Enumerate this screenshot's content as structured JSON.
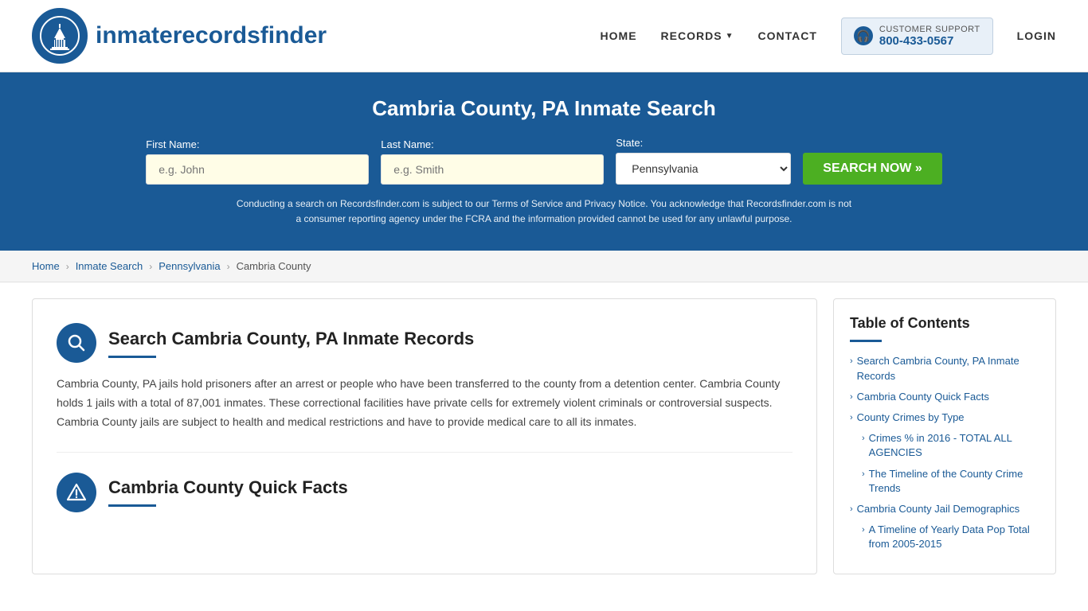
{
  "header": {
    "logo_text_normal": "inmaterecords",
    "logo_text_bold": "finder",
    "nav": {
      "home": "HOME",
      "records": "RECORDS",
      "contact": "CONTACT",
      "login": "LOGIN"
    },
    "support": {
      "label": "CUSTOMER SUPPORT",
      "phone": "800-433-0567"
    }
  },
  "search_banner": {
    "title": "Cambria County, PA Inmate Search",
    "form": {
      "first_name_label": "First Name:",
      "first_name_placeholder": "e.g. John",
      "last_name_label": "Last Name:",
      "last_name_placeholder": "e.g. Smith",
      "state_label": "State:",
      "state_value": "Pennsylvania",
      "search_button": "SEARCH NOW »"
    },
    "disclaimer": "Conducting a search on Recordsfinder.com is subject to our Terms of Service and Privacy Notice. You acknowledge that Recordsfinder.com is not a consumer reporting agency under the FCRA and the information provided cannot be used for any unlawful purpose."
  },
  "breadcrumb": {
    "items": [
      "Home",
      "Inmate Search",
      "Pennsylvania",
      "Cambria County"
    ]
  },
  "main": {
    "section1": {
      "title": "Search Cambria County, PA Inmate Records",
      "text": "Cambria County, PA jails hold prisoners after an arrest or people who have been transferred to the county from a detention center. Cambria County holds 1 jails with a total of 87,001 inmates. These correctional facilities have private cells for extremely violent criminals or controversial suspects. Cambria County jails are subject to health and medical restrictions and have to provide medical care to all its inmates."
    },
    "section2": {
      "title": "Cambria County Quick Facts"
    }
  },
  "sidebar": {
    "title": "Table of Contents",
    "items": [
      {
        "label": "Search Cambria County, PA Inmate Records",
        "sub": false
      },
      {
        "label": "Cambria County Quick Facts",
        "sub": false
      },
      {
        "label": "County Crimes by Type",
        "sub": false
      },
      {
        "label": "Crimes % in 2016 - TOTAL ALL AGENCIES",
        "sub": true
      },
      {
        "label": "The Timeline of the County Crime Trends",
        "sub": true
      },
      {
        "label": "Cambria County Jail Demographics",
        "sub": false
      },
      {
        "label": "A Timeline of Yearly Data Pop Total from 2005-2015",
        "sub": true
      }
    ]
  }
}
